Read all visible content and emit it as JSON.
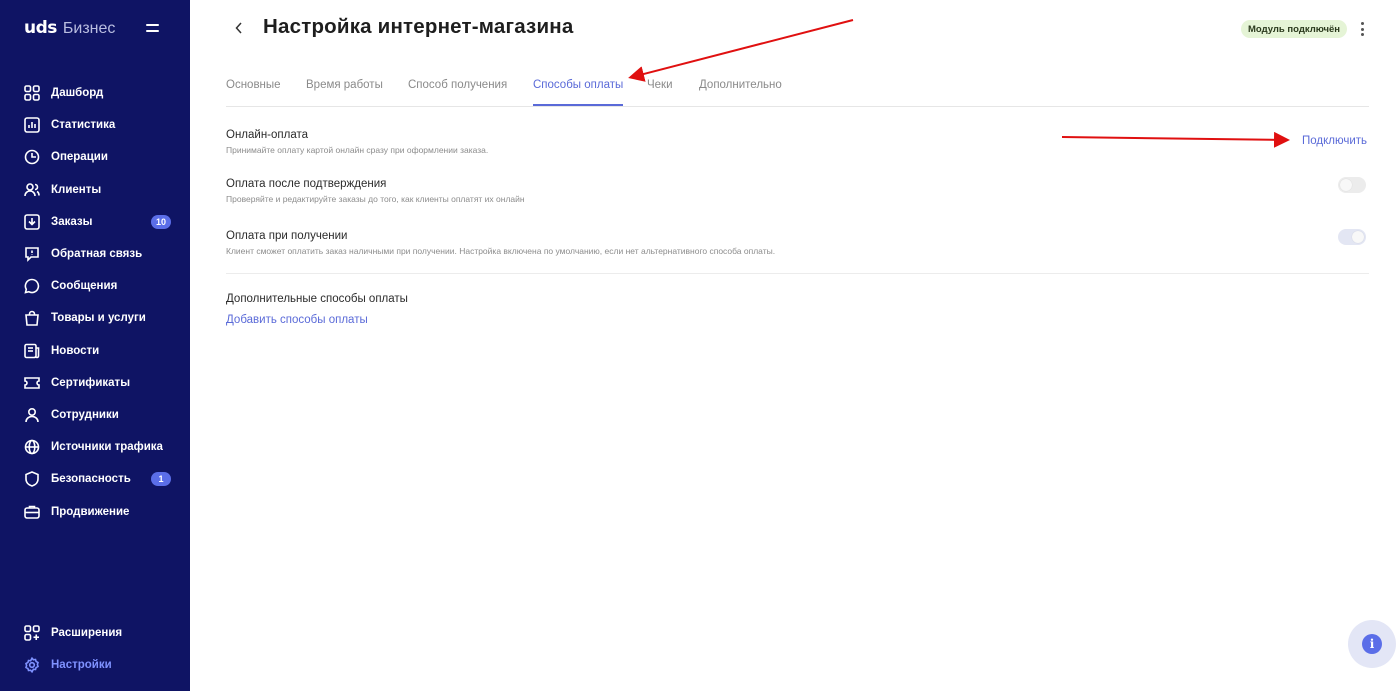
{
  "sidebar": {
    "brand": {
      "logo": "uds",
      "product": "Бизнес"
    },
    "items": [
      {
        "label": "Дашборд",
        "icon": "dashboard-icon"
      },
      {
        "label": "Статистика",
        "icon": "chart-icon"
      },
      {
        "label": "Операции",
        "icon": "operations-icon"
      },
      {
        "label": "Клиенты",
        "icon": "users-icon"
      },
      {
        "label": "Заказы",
        "icon": "orders-icon",
        "badge": "10"
      },
      {
        "label": "Обратная связь",
        "icon": "feedback-icon"
      },
      {
        "label": "Сообщения",
        "icon": "chat-icon"
      },
      {
        "label": "Товары и услуги",
        "icon": "bag-icon"
      },
      {
        "label": "Новости",
        "icon": "news-icon"
      },
      {
        "label": "Сертификаты",
        "icon": "ticket-icon"
      },
      {
        "label": "Сотрудники",
        "icon": "employee-icon"
      },
      {
        "label": "Источники трафика",
        "icon": "globe-icon"
      },
      {
        "label": "Безопасность",
        "icon": "shield-icon",
        "badge": "1"
      },
      {
        "label": "Продвижение",
        "icon": "promotion-icon"
      }
    ],
    "bottom": [
      {
        "label": "Расширения",
        "icon": "extensions-icon"
      },
      {
        "label": "Настройки",
        "icon": "gear-icon",
        "active": true
      }
    ]
  },
  "header": {
    "title": "Настройка интернет-магазина",
    "status_badge": "Модуль подключён"
  },
  "tabs": [
    {
      "label": "Основные"
    },
    {
      "label": "Время работы"
    },
    {
      "label": "Способ получения"
    },
    {
      "label": "Способы оплаты",
      "active": true
    },
    {
      "label": "Чеки"
    },
    {
      "label": "Дополнительно"
    }
  ],
  "settings": {
    "online": {
      "title": "Онлайн-оплата",
      "desc": "Принимайте оплату картой онлайн сразу при оформлении заказа.",
      "action": "Подключить"
    },
    "after_confirm": {
      "title": "Оплата после подтверждения",
      "desc": "Проверяйте и редактируйте заказы до того, как клиенты оплатят их онлайн",
      "enabled": false
    },
    "on_receipt": {
      "title": "Оплата при получении",
      "desc": "Клиент сможет оплатить заказ наличными при получении. Настройка включена по умолчанию, если нет альтернативного способа оплаты.",
      "enabled": true
    },
    "extra": {
      "title": "Дополнительные способы оплаты",
      "action": "Добавить способы оплаты"
    }
  },
  "colors": {
    "sidebar_bg": "#0f1464",
    "accent": "#5a6ad8",
    "badge_bg": "#5b6ee8",
    "status_bg": "#e5f4d6",
    "annotation_arrow": "#e01010"
  }
}
